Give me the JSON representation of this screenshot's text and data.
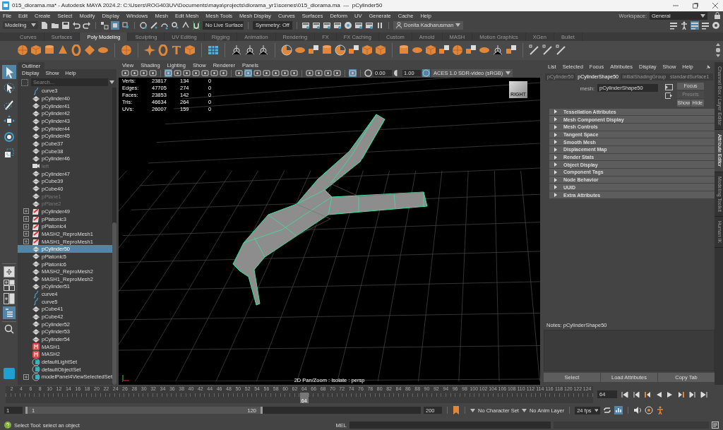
{
  "window": {
    "title": "015_diorama.ma* - Autodesk MAYA 2024.2: C:\\Users\\ROG403UV\\Documents\\maya\\projects\\diorama_yr1\\scenes\\015_diorama.ma  ---  pCylinder50"
  },
  "menu_bar": [
    "File",
    "Edit",
    "Create",
    "Select",
    "Modify",
    "Display",
    "Windows",
    "Mesh",
    "Edit Mesh",
    "Mesh Tools",
    "Mesh Display",
    "Curves",
    "Surfaces",
    "Deform",
    "UV",
    "Generate",
    "Cache",
    "Help"
  ],
  "workspace": {
    "label": "Workspace:",
    "value": "General"
  },
  "status_line": {
    "menu_set": "Modeling",
    "live_surface": "No Live Surface",
    "symmetry": "Symmetry: Off",
    "user": "Donita Kadharusman"
  },
  "shelf_tabs": [
    {
      "label": "Curves",
      "selected": false
    },
    {
      "label": "Surfaces",
      "selected": false
    },
    {
      "label": "Poly Modeling",
      "selected": true
    },
    {
      "label": "Sculpting",
      "selected": false
    },
    {
      "label": "UV Editing",
      "selected": false
    },
    {
      "label": "Rigging",
      "selected": false
    },
    {
      "label": "Animation",
      "selected": false
    },
    {
      "label": "Rendering",
      "selected": false
    },
    {
      "label": "FX",
      "selected": false
    },
    {
      "label": "FX Caching",
      "selected": false
    },
    {
      "label": "Custom",
      "selected": false
    },
    {
      "label": "Arnold",
      "selected": false
    },
    {
      "label": "MASH",
      "selected": false
    },
    {
      "label": "Motion Graphics",
      "selected": false
    },
    {
      "label": "XGen",
      "selected": false
    },
    {
      "label": "Bullet",
      "selected": false
    }
  ],
  "tools": [
    {
      "kind": "select",
      "selected": true
    },
    {
      "kind": "lasso",
      "selected": false
    },
    {
      "kind": "paint",
      "selected": false
    },
    {
      "kind": "move",
      "selected": false
    },
    {
      "kind": "rotate",
      "selected": false
    },
    {
      "kind": "scale",
      "selected": false
    }
  ],
  "outliner": {
    "title": "Outliner",
    "menu": [
      "Display",
      "Show",
      "Help"
    ],
    "placeholder": "Search...",
    "items": [
      {
        "label": "curve3",
        "kind": "curve",
        "selected": false,
        "disabled": false,
        "collapsed": false
      },
      {
        "label": "pCylinder40",
        "kind": "mesh",
        "selected": false,
        "disabled": false,
        "collapsed": false
      },
      {
        "label": "pCylinder41",
        "kind": "mesh",
        "selected": false,
        "disabled": false,
        "collapsed": false
      },
      {
        "label": "pCylinder42",
        "kind": "mesh",
        "selected": false,
        "disabled": false,
        "collapsed": false
      },
      {
        "label": "pCylinder43",
        "kind": "mesh",
        "selected": false,
        "disabled": false,
        "collapsed": false
      },
      {
        "label": "pCylinder44",
        "kind": "mesh",
        "selected": false,
        "disabled": false,
        "collapsed": false
      },
      {
        "label": "pCylinder45",
        "kind": "mesh",
        "selected": false,
        "disabled": false,
        "collapsed": false
      },
      {
        "label": "pCube37",
        "kind": "mesh",
        "selected": false,
        "disabled": false,
        "collapsed": false
      },
      {
        "label": "pCube38",
        "kind": "mesh",
        "selected": false,
        "disabled": false,
        "collapsed": false
      },
      {
        "label": "pCylinder46",
        "kind": "mesh",
        "selected": false,
        "disabled": false,
        "collapsed": false
      },
      {
        "label": "left",
        "kind": "camera",
        "selected": false,
        "disabled": true,
        "collapsed": false
      },
      {
        "label": "pCylinder47",
        "kind": "mesh",
        "selected": false,
        "disabled": false,
        "collapsed": false
      },
      {
        "label": "pCube39",
        "kind": "mesh",
        "selected": false,
        "disabled": false,
        "collapsed": false
      },
      {
        "label": "pCube40",
        "kind": "mesh",
        "selected": false,
        "disabled": false,
        "collapsed": false
      },
      {
        "label": "pPlane1",
        "kind": "mesh",
        "selected": false,
        "disabled": true,
        "collapsed": false
      },
      {
        "label": "pPlane2",
        "kind": "mesh",
        "selected": false,
        "disabled": true,
        "collapsed": false
      },
      {
        "label": "pCylinder49",
        "kind": "mash_mesh",
        "selected": false,
        "disabled": false,
        "collapsed": true
      },
      {
        "label": "pPlatonic3",
        "kind": "mash_mesh",
        "selected": false,
        "disabled": false,
        "collapsed": true
      },
      {
        "label": "pPlatonic4",
        "kind": "mash_mesh",
        "selected": false,
        "disabled": false,
        "collapsed": true
      },
      {
        "label": "MASH2_ReproMesh1",
        "kind": "mash_mesh",
        "selected": false,
        "disabled": false,
        "collapsed": true
      },
      {
        "label": "MASH1_ReproMesh1",
        "kind": "mash_mesh",
        "selected": false,
        "disabled": false,
        "collapsed": true
      },
      {
        "label": "pCylinder50",
        "kind": "mesh",
        "selected": true,
        "disabled": false,
        "collapsed": false
      },
      {
        "label": "pPlatonic5",
        "kind": "mesh",
        "selected": false,
        "disabled": false,
        "collapsed": false
      },
      {
        "label": "pPlatonic6",
        "kind": "mesh",
        "selected": false,
        "disabled": false,
        "collapsed": false
      },
      {
        "label": "MASH2_ReproMesh2",
        "kind": "mesh",
        "selected": false,
        "disabled": false,
        "collapsed": false
      },
      {
        "label": "MASH1_ReproMesh2",
        "kind": "mesh",
        "selected": false,
        "disabled": false,
        "collapsed": false
      },
      {
        "label": "pCylinder51",
        "kind": "mesh",
        "selected": false,
        "disabled": false,
        "collapsed": false
      },
      {
        "label": "curve4",
        "kind": "curve",
        "selected": false,
        "disabled": false,
        "collapsed": false
      },
      {
        "label": "curve5",
        "kind": "curve",
        "selected": false,
        "disabled": false,
        "collapsed": false
      },
      {
        "label": "pCube41",
        "kind": "mesh",
        "selected": false,
        "disabled": false,
        "collapsed": false
      },
      {
        "label": "pCube42",
        "kind": "mesh",
        "selected": false,
        "disabled": false,
        "collapsed": false
      },
      {
        "label": "pCylinder52",
        "kind": "mesh",
        "selected": false,
        "disabled": false,
        "collapsed": false
      },
      {
        "label": "pCylinder53",
        "kind": "mesh",
        "selected": false,
        "disabled": false,
        "collapsed": false
      },
      {
        "label": "pCylinder54",
        "kind": "mesh",
        "selected": false,
        "disabled": false,
        "collapsed": false
      },
      {
        "label": "MASH1",
        "kind": "mash",
        "selected": false,
        "disabled": false,
        "collapsed": false
      },
      {
        "label": "MASH2",
        "kind": "mash",
        "selected": false,
        "disabled": false,
        "collapsed": false
      },
      {
        "label": "defaultLightSet",
        "kind": "set",
        "selected": false,
        "disabled": false,
        "collapsed": false
      },
      {
        "label": "defaultObjectSet",
        "kind": "set",
        "selected": false,
        "disabled": false,
        "collapsed": false
      },
      {
        "label": "modelPanel4ViewSelectedSet",
        "kind": "set",
        "selected": false,
        "disabled": false,
        "collapsed": true
      }
    ]
  },
  "viewport": {
    "menu": [
      "View",
      "Shading",
      "Lighting",
      "Show",
      "Renderer",
      "Panels"
    ],
    "exposure": "0.00",
    "gamma": "1.00",
    "color_space": "ACES 1.0 SDR-video (sRGB)",
    "hud": [
      {
        "label": "Verts:",
        "values": [
          "23817",
          "134",
          "0"
        ]
      },
      {
        "label": "Edges:",
        "values": [
          "47705",
          "274",
          "0"
        ]
      },
      {
        "label": "Faces:",
        "values": [
          "23853",
          "142",
          "0"
        ]
      },
      {
        "label": "Tris:",
        "values": [
          "46634",
          "264",
          "0"
        ]
      },
      {
        "label": "UVs:",
        "values": [
          "26007",
          "159",
          "0"
        ]
      }
    ],
    "view_cube": "RIGHT",
    "footer": "2D Pan/Zoom : Isolate : persp"
  },
  "attribute_editor": {
    "menu": [
      "List",
      "Selected",
      "Focus",
      "Attributes",
      "Display",
      "Show",
      "Help"
    ],
    "tabs": [
      {
        "label": "pCylinder50",
        "selected": false
      },
      {
        "label": "pCylinderShape50",
        "selected": true
      },
      {
        "label": "initialShadingGroup",
        "selected": false
      },
      {
        "label": "standardSurface1",
        "selected": false
      }
    ],
    "mesh_label": "mesh:",
    "mesh_value": "pCylinderShape50",
    "buttons": [
      {
        "label": "Focus",
        "disabled": false
      },
      {
        "label": "Presets",
        "disabled": true
      },
      {
        "label": "Show",
        "disabled": false
      },
      {
        "label": "Hide",
        "disabled": false
      }
    ],
    "sections": [
      {
        "label": "Tessellation Attributes",
        "expanded": false
      },
      {
        "label": "Mesh Component Display",
        "expanded": false
      },
      {
        "label": "Mesh Controls",
        "expanded": false
      },
      {
        "label": "Tangent Space",
        "expanded": false
      },
      {
        "label": "Smooth Mesh",
        "expanded": false
      },
      {
        "label": "Displacement Map",
        "expanded": false
      },
      {
        "label": "Render Stats",
        "expanded": false
      },
      {
        "label": "Object Display",
        "expanded": false
      },
      {
        "label": "Component Tags",
        "expanded": false
      },
      {
        "label": "Node Behavior",
        "expanded": false
      },
      {
        "label": "UUID",
        "expanded": false
      },
      {
        "label": "Extra Attributes",
        "expanded": false
      }
    ],
    "notes": "Notes:  pCylinderShape50",
    "bottom_buttons": [
      "Select",
      "Load Attributes",
      "Copy Tab"
    ]
  },
  "side_tabs": [
    {
      "label": "Channel Box / Layer Editor",
      "selected": false
    },
    {
      "label": "Attribute Editor",
      "selected": true
    },
    {
      "label": "Modeling Toolkit",
      "selected": false
    },
    {
      "label": "Human IK",
      "selected": false
    }
  ],
  "timeline": {
    "ticks": [
      "2",
      "4",
      "6",
      "8",
      "10",
      "12",
      "14",
      "16",
      "18",
      "20",
      "22",
      "24",
      "26",
      "28",
      "30",
      "32",
      "34",
      "36",
      "38",
      "40",
      "42",
      "44",
      "46",
      "48",
      "50",
      "52",
      "54",
      "56",
      "58",
      "60",
      "62",
      "64",
      "66",
      "68",
      "70",
      "72",
      "74",
      "76",
      "78",
      "80",
      "82",
      "84",
      "86",
      "88",
      "90",
      "92",
      "94",
      "96",
      "98",
      "100",
      "102",
      "104",
      "106",
      "108",
      "110",
      "112",
      "114",
      "116",
      "118",
      "120",
      "122",
      "124"
    ],
    "playhead": {
      "frame": "64",
      "level": 0.508
    },
    "frame_field": "64"
  },
  "range": {
    "start": "1",
    "range_start": "1",
    "range_end": "120",
    "end": "200",
    "level": 0.6,
    "character_set": "No Character Set",
    "anim_layer": "No Anim Layer",
    "fps": "24 fps"
  },
  "help_line": {
    "text": "Select Tool: select an object",
    "command_label": "MEL"
  }
}
